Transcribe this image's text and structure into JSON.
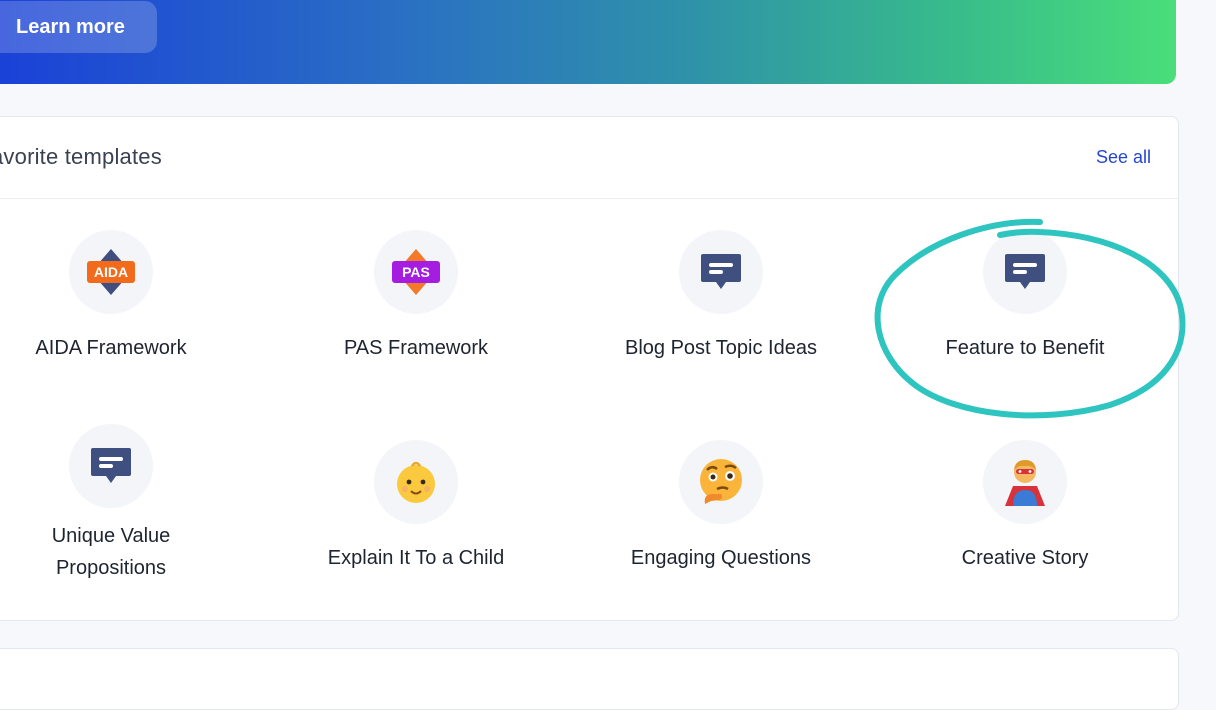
{
  "banner": {
    "learn_more_label": "Learn more"
  },
  "favorites": {
    "title": "avorite templates",
    "see_all_label": "See all",
    "templates": [
      {
        "label": "AIDA Framework",
        "icon": "aida-badge-icon",
        "badge_text": "AIDA"
      },
      {
        "label": "PAS Framework",
        "icon": "pas-badge-icon",
        "badge_text": "PAS"
      },
      {
        "label": "Blog Post Topic Ideas",
        "icon": "chat-bubble-icon"
      },
      {
        "label": "Feature to Benefit",
        "icon": "chat-bubble-icon"
      },
      {
        "label": "Unique Value Propositions",
        "icon": "chat-bubble-icon"
      },
      {
        "label": "Explain It To a Child",
        "icon": "baby-face-icon"
      },
      {
        "label": "Engaging Questions",
        "icon": "thinking-face-icon"
      },
      {
        "label": "Creative Story",
        "icon": "superhero-icon"
      }
    ]
  },
  "colors": {
    "accent_link": "#2547d0",
    "annotation_circle": "#2ec4bf",
    "aida_badge": "#f26a1b",
    "pas_badge": "#a41de0",
    "chat_icon": "#3f4f80"
  }
}
